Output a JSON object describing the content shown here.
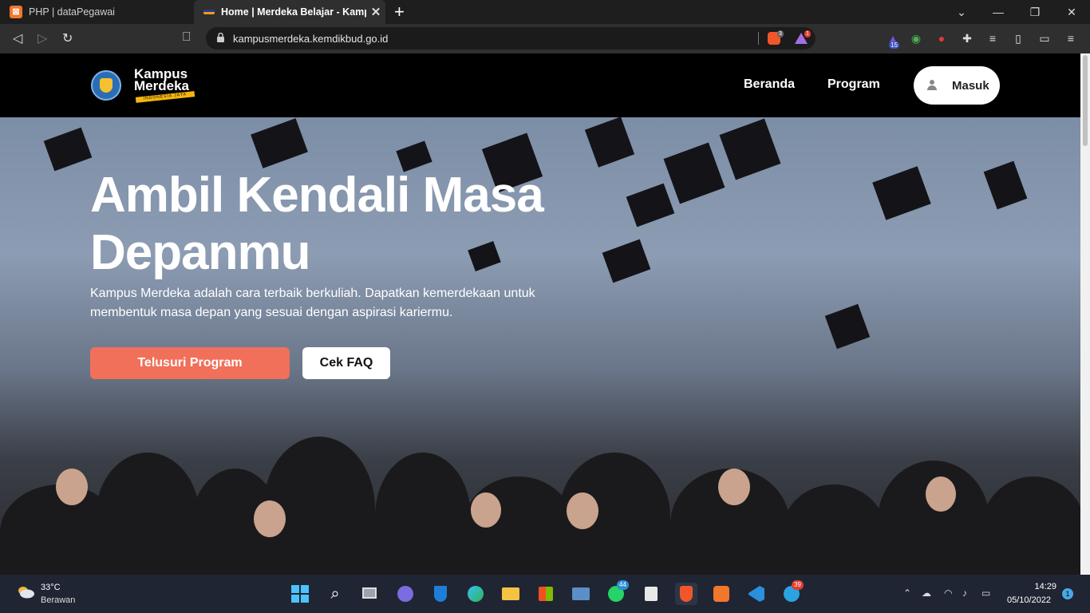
{
  "browser": {
    "tabs": [
      {
        "title": "PHP | dataPegawai",
        "active": false
      },
      {
        "title": "Home | Merdeka Belajar - Kampus",
        "active": true
      }
    ],
    "url": "kampusmerdeka.kemdikbud.go.id",
    "badges": {
      "brave_shield": "3",
      "rewards": "1",
      "extension_count": "15"
    }
  },
  "site": {
    "logo": {
      "line1": "Kampus",
      "line2": "Merdeka",
      "tagline": "INDONESIA JAYA"
    },
    "nav": {
      "home": "Beranda",
      "program": "Program",
      "login": "Masuk"
    },
    "hero": {
      "title": "Ambil Kendali Masa Depanmu",
      "description": "Kampus Merdeka adalah cara terbaik berkuliah. Dapatkan kemerdekaan untuk membentuk masa depan yang sesuai dengan aspirasi kariermu.",
      "primary_button": "Telusuri Program",
      "secondary_button": "Cek FAQ"
    },
    "colors": {
      "primary": "#f0705a",
      "header_bg": "#000000"
    }
  },
  "taskbar": {
    "weather": {
      "temp": "33°C",
      "condition": "Berawan"
    },
    "badges": {
      "whatsapp": "44",
      "telegram": "39"
    },
    "clock": {
      "time": "14:29",
      "date": "05/10/2022"
    },
    "notifications": "1"
  }
}
